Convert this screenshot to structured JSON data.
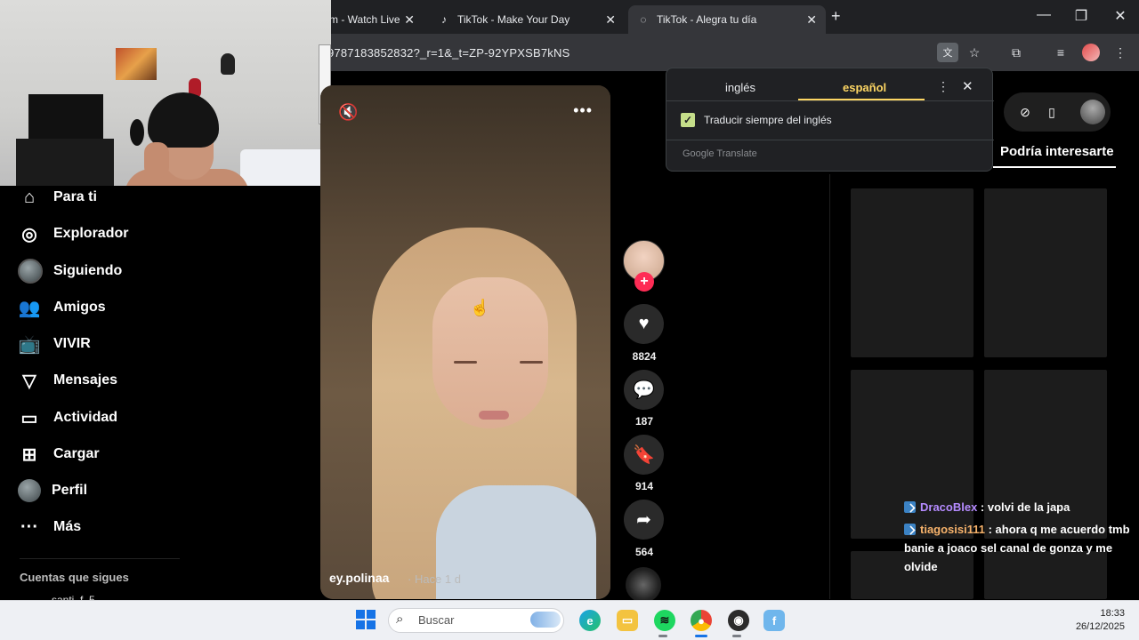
{
  "browser": {
    "tabs": [
      {
        "label": "m - Watch Live",
        "icon": "twitch-icon"
      },
      {
        "label": "TikTok - Make Your Day",
        "icon": "tiktok-icon"
      },
      {
        "label": "TikTok - Alegra tu día",
        "icon": "loading-icon",
        "active": true
      }
    ],
    "url": "9787183852832?_r=1&_t=ZP-92YPXSB7kNS"
  },
  "sidebar": {
    "items": [
      {
        "label": "Para ti",
        "icon": "home-icon"
      },
      {
        "label": "Explorador",
        "icon": "compass-icon"
      },
      {
        "label": "Siguiendo",
        "icon": "following-avatar"
      },
      {
        "label": "Amigos",
        "icon": "friends-icon"
      },
      {
        "label": "VIVIR",
        "icon": "live-tv-icon"
      },
      {
        "label": "Mensajes",
        "icon": "send-icon"
      },
      {
        "label": "Actividad",
        "icon": "activity-icon"
      },
      {
        "label": "Cargar",
        "icon": "upload-icon"
      },
      {
        "label": "Perfil",
        "icon": "profile-avatar"
      },
      {
        "label": "Más",
        "icon": "more-icon"
      }
    ],
    "following_title": "Cuentas que sigues",
    "following_partial": "santi_f_5"
  },
  "video": {
    "author": "ey.polinaa",
    "time": "· Hace 1 d"
  },
  "actions": {
    "likes": "8824",
    "comments": "187",
    "saves": "914",
    "shares": "564"
  },
  "translate_popup": {
    "lang_from": "inglés",
    "lang_to": "español",
    "checkbox_label": "Traducir siempre del inglés",
    "checkbox_checked": true,
    "brand": "Google Translate"
  },
  "right_panel": {
    "title": "Podría interesarte"
  },
  "chat": [
    {
      "user": "DracoBlex",
      "message": " : volvi de la japa"
    },
    {
      "user": "tiagosisi111",
      "message": " : ahora q me acuerdo tmb banie a joaco sel canal de gonza y me olvide"
    }
  ],
  "taskbar": {
    "search_placeholder": "Buscar",
    "time": "18:33",
    "date": "26/12/2025",
    "apps": [
      "edge-icon",
      "file-explorer-icon",
      "spotify-icon",
      "chrome-icon",
      "obs-icon",
      "app-f-icon"
    ]
  },
  "colors": {
    "tiktok_red": "#fe2c55",
    "translate_accent": "#fdd663",
    "chat_user1": "#b58bff",
    "chat_user2": "#f6b26b"
  }
}
